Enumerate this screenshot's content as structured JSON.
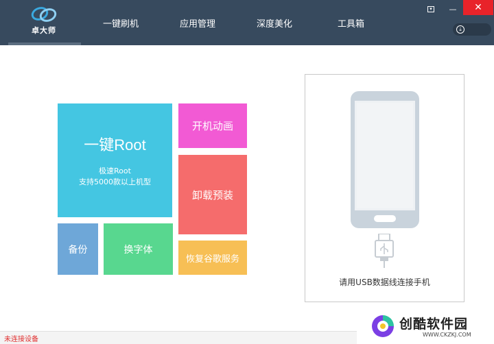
{
  "app": {
    "logo_text": "卓大师",
    "accent": "#374a5e"
  },
  "nav": {
    "items": [
      {
        "label": "一键刷机"
      },
      {
        "label": "应用管理"
      },
      {
        "label": "深度美化"
      },
      {
        "label": "工具箱"
      }
    ]
  },
  "window": {
    "menu_icon": "▾",
    "min_icon": "—",
    "close_icon": "✕",
    "download_icon": "⤓"
  },
  "tiles": {
    "root": {
      "title": "一键Root",
      "line1": "极速Root",
      "line2": "支持5000款以上机型",
      "color": "#44c6e2"
    },
    "boot_animation": {
      "label": "开机动画",
      "color": "#f25ad4"
    },
    "uninstall": {
      "label": "卸载预装",
      "color": "#f56c6c"
    },
    "backup": {
      "label": "备份",
      "color": "#6ea7d8"
    },
    "font": {
      "label": "换字体",
      "color": "#58d78f"
    },
    "google": {
      "label": "恢复谷歌服务",
      "color": "#f7bf55"
    }
  },
  "device_panel": {
    "caption": "请用USB数据线连接手机"
  },
  "status": {
    "text": "未连接设备"
  },
  "watermark": {
    "title": "创酷软件园",
    "url": "WWW.CKZKJ.COM"
  }
}
